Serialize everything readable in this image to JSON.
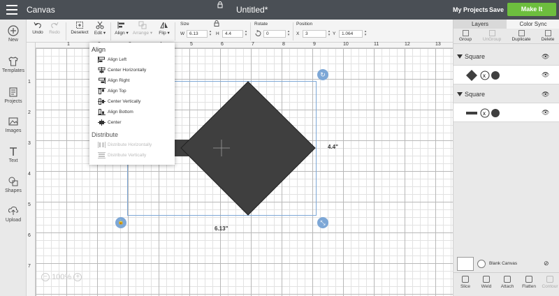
{
  "topbar": {
    "app_title": "Canvas",
    "doc_title": "Untitled*",
    "my_projects": "My Projects",
    "save": "Save",
    "make_it": "Make It",
    "make_it_color": "#6dbe3e"
  },
  "leftnav": {
    "items": [
      {
        "label": "New",
        "icon": "plus-circle-icon"
      },
      {
        "label": "Templates",
        "icon": "shirt-icon"
      },
      {
        "label": "Projects",
        "icon": "projects-icon"
      },
      {
        "label": "Images",
        "icon": "image-icon"
      },
      {
        "label": "Text",
        "icon": "text-icon"
      },
      {
        "label": "Shapes",
        "icon": "shapes-icon"
      },
      {
        "label": "Upload",
        "icon": "upload-icon"
      }
    ]
  },
  "toolbar": {
    "undo": "Undo",
    "redo": "Redo",
    "deselect": "Deselect",
    "edit": "Edit ▾",
    "align": "Align ▾",
    "arrange": "Arrange ▾",
    "flip": "Flip ▾",
    "size_label": "Size",
    "w_label": "W",
    "w_value": "6.13",
    "h_label": "H",
    "h_value": "4.4",
    "rotate_label": "Rotate",
    "rotate_value": "0",
    "position_label": "Position",
    "x_label": "X",
    "x_value": "3",
    "y_label": "Y",
    "y_value": "1.064"
  },
  "align_menu": {
    "align_header": "Align",
    "align_items": [
      "Align Left",
      "Center Horizontally",
      "Align Right",
      "Align Top",
      "Center Vertically",
      "Align Bottom",
      "Center"
    ],
    "distribute_header": "Distribute",
    "distribute_items": [
      "Distribute Horizontally",
      "Distribute Vertically"
    ]
  },
  "ruler": {
    "top": [
      "1",
      "2",
      "3",
      "4",
      "5",
      "6",
      "7",
      "8",
      "9",
      "10",
      "11",
      "12",
      "13"
    ],
    "left": [
      "1",
      "2",
      "3",
      "4",
      "5",
      "6",
      "7"
    ]
  },
  "selection": {
    "width_label": "6.13\"",
    "height_label": "4.4\""
  },
  "zoom": {
    "value": "100%",
    "minus": "−",
    "plus": "+"
  },
  "rightpanel": {
    "tabs": [
      "Layers",
      "Color Sync"
    ],
    "actions": [
      {
        "label": "Group",
        "enabled": true
      },
      {
        "label": "UnGroup",
        "enabled": false
      },
      {
        "label": "Duplicate",
        "enabled": true
      },
      {
        "label": "Delete",
        "enabled": true
      }
    ],
    "groups": [
      {
        "name": "Square"
      },
      {
        "name": "Square"
      }
    ],
    "blank_canvas": "Blank Canvas",
    "bottom_actions": [
      {
        "label": "Slice",
        "enabled": true
      },
      {
        "label": "Weld",
        "enabled": true
      },
      {
        "label": "Attach",
        "enabled": true
      },
      {
        "label": "Flatten",
        "enabled": true
      },
      {
        "label": "Contour",
        "enabled": false
      }
    ]
  },
  "colors": {
    "topbar": "#4a4f55",
    "shape_fill": "#3f3f3f",
    "selection": "#7da7d6"
  }
}
